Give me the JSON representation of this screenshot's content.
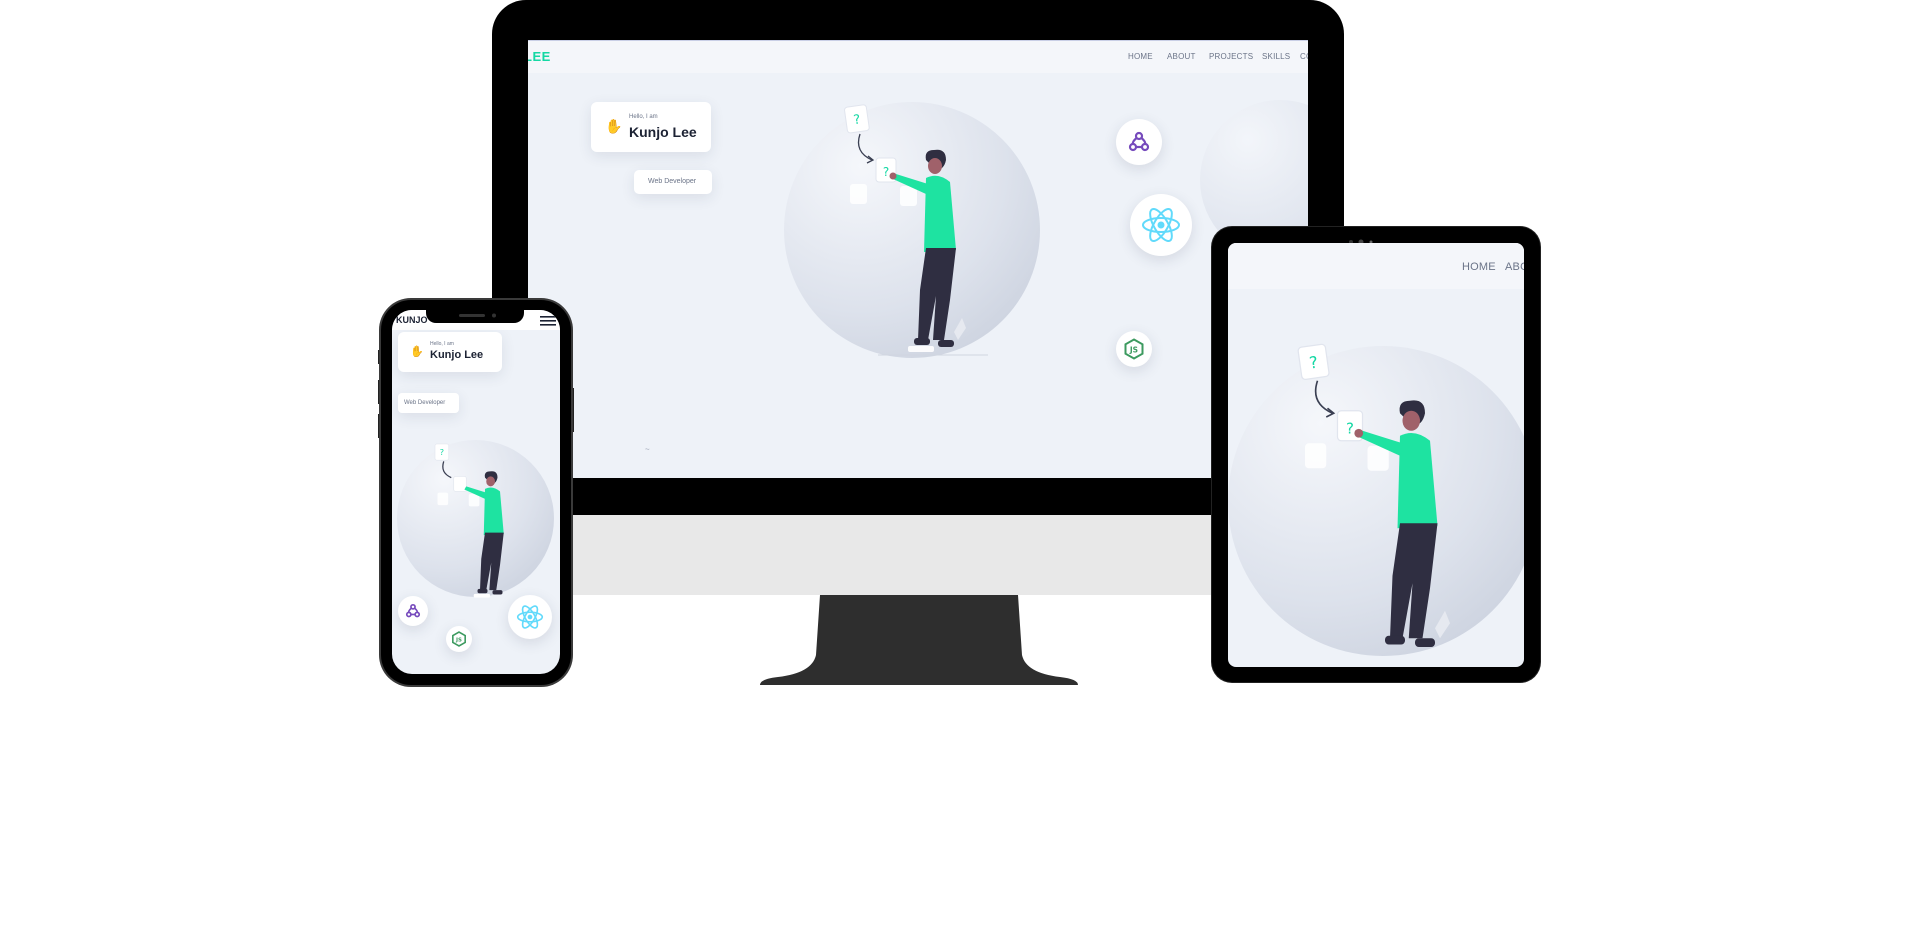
{
  "brand": {
    "logo_text": "LEE",
    "phone_logo_text": "KUNJO"
  },
  "nav": {
    "items": [
      "HOME",
      "ABOUT",
      "PROJECTS",
      "SKILLS",
      "CO"
    ],
    "tablet_items": [
      "HOME",
      "ABO"
    ]
  },
  "hero": {
    "greeting": "Hello, I am",
    "name": "Kunjo Lee",
    "role": "Web Developer",
    "scroll_mark": "~"
  },
  "illustration": {
    "question_mark": "?",
    "hook_mark": "?"
  },
  "tech_icons": [
    "redux-icon",
    "react-icon",
    "nodejs-icon"
  ],
  "colors": {
    "accent": "#14d8a4",
    "figure_shirt": "#1ee3a1",
    "figure_pants": "#2f2e41",
    "device_frame": "#000000",
    "monitor_chin": "#e8e8e8",
    "monitor_stand": "#2e2e2e",
    "screen_bg": "#eef2f8",
    "redux": "#764abc",
    "react": "#61dafb",
    "node": "#3c9a5f"
  }
}
